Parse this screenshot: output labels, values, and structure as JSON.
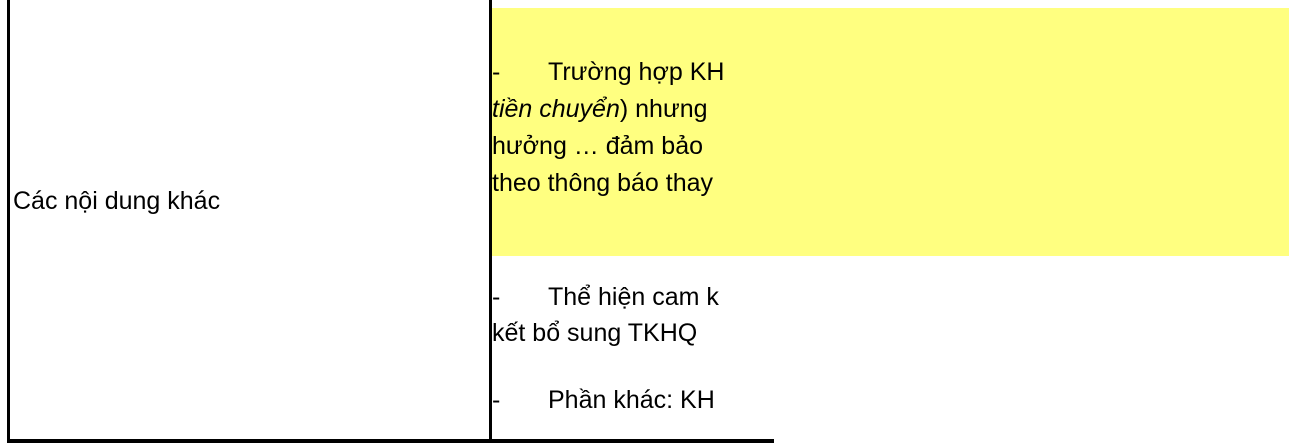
{
  "row": {
    "label": "Các nội dung khác"
  },
  "content": {
    "para1": {
      "dash": "-",
      "line1": "Trường hợp KH",
      "line2_italic": "tiền chuyển",
      "line2_rest": ") nhưng",
      "line3": "hưởng … đảm bảo",
      "line4": "theo thông báo thay"
    },
    "para2": {
      "dash": "-",
      "line1": "Thể hiện cam k",
      "line2": "kết bổ sung TKHQ"
    },
    "para3": {
      "dash": "-",
      "line1": "Phần khác: KH"
    }
  },
  "colors": {
    "highlight": "#ffff80",
    "border": "#000000",
    "text": "#000000"
  }
}
